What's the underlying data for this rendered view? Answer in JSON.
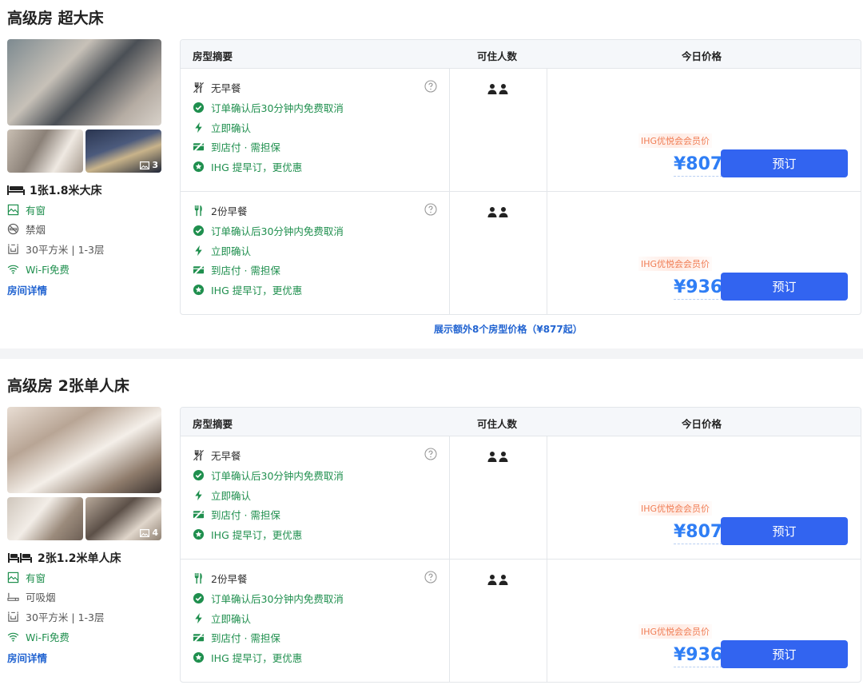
{
  "rooms": [
    {
      "title": "高级房 超大床",
      "photo_count": "3",
      "bed": "1张1.8米大床",
      "features": [
        {
          "icon": "window-icon",
          "text": "有窗"
        },
        {
          "icon": "no-smoking-icon",
          "text": "禁烟"
        },
        {
          "icon": "area-icon",
          "text": "30平方米 | 1-3层"
        },
        {
          "icon": "wifi-icon",
          "text": "Wi-Fi免费"
        }
      ],
      "details_label": "房间详情",
      "more_label": "展示额外8个房型价格（¥877起）",
      "plans": [
        {
          "meal": "无早餐",
          "cancel": "订单确认后30分钟内免费取消",
          "confirm": "立即确认",
          "payment": "到店付 · 需担保",
          "ihg": "IHG 提早订，更优惠",
          "member_tag": "IHG优悦会会员价",
          "price": "¥807",
          "book_label": "预订"
        },
        {
          "meal": "2份早餐",
          "cancel": "订单确认后30分钟内免费取消",
          "confirm": "立即确认",
          "payment": "到店付 · 需担保",
          "ihg": "IHG 提早订，更优惠",
          "member_tag": "IHG优悦会会员价",
          "price": "¥936",
          "book_label": "预订"
        }
      ]
    },
    {
      "title": "高级房 2张单人床",
      "photo_count": "4",
      "bed": "2张1.2米单人床",
      "features": [
        {
          "icon": "window-icon",
          "text": "有窗"
        },
        {
          "icon": "smoking-icon",
          "text": "可吸烟"
        },
        {
          "icon": "area-icon",
          "text": "30平方米 | 1-3层"
        },
        {
          "icon": "wifi-icon",
          "text": "Wi-Fi免费"
        }
      ],
      "details_label": "房间详情",
      "plans": [
        {
          "meal": "无早餐",
          "cancel": "订单确认后30分钟内免费取消",
          "confirm": "立即确认",
          "payment": "到店付 · 需担保",
          "ihg": "IHG 提早订，更优惠",
          "member_tag": "IHG优悦会会员价",
          "price": "¥807",
          "book_label": "预订"
        },
        {
          "meal": "2份早餐",
          "cancel": "订单确认后30分钟内免费取消",
          "confirm": "立即确认",
          "payment": "到店付 · 需担保",
          "ihg": "IHG 提早订，更优惠",
          "member_tag": "IHG优悦会会员价",
          "price": "¥936",
          "book_label": "预订"
        }
      ]
    }
  ],
  "table_headers": {
    "summary": "房型摘要",
    "guests": "可住人数",
    "price": "今日价格"
  },
  "colors": {
    "accent_blue": "#3264f0",
    "price_blue": "#2f7ef5",
    "link_blue": "#2264d1",
    "perk_green": "#1f8f4e",
    "member_orange": "#f07c53"
  }
}
